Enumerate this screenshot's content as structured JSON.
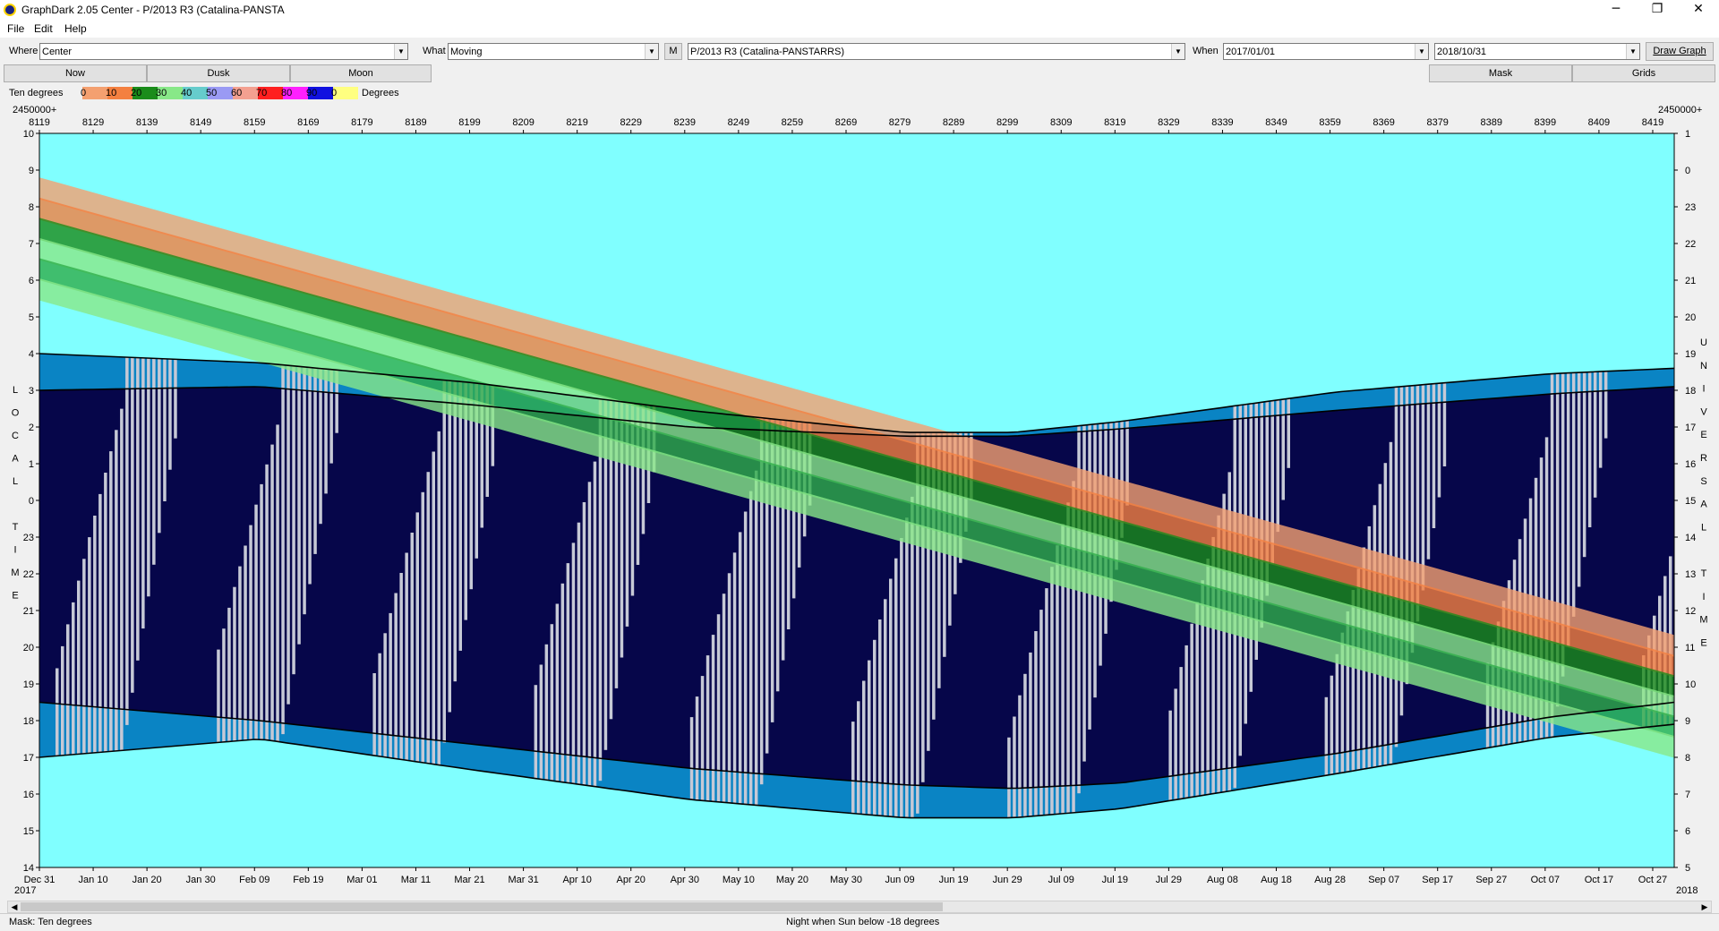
{
  "window": {
    "title": "GraphDark 2.05  Center  -  P/2013 R3 (Catalina-PANSTA",
    "minimize": "─",
    "restore": "❐",
    "close": "✕"
  },
  "menu": [
    "File",
    "Edit",
    "Help"
  ],
  "toolbar": {
    "where_label": "Where",
    "where_value": "Center",
    "what_label": "What",
    "what_value": "Moving",
    "m_button": "M",
    "object_value": "P/2013 R3 (Catalina-PANSTARRS)",
    "when_label": "When",
    "start_date": "2017/01/01",
    "end_date": "2018/10/31",
    "draw_button": "Draw Graph"
  },
  "tabs": {
    "now": "Now",
    "dusk": "Dusk",
    "moon": "Moon",
    "mask": "Mask",
    "grids": "Grids"
  },
  "legend": {
    "title": "Ten degrees",
    "items": [
      {
        "label": "0",
        "color": "#f4a070"
      },
      {
        "label": "10",
        "color": "#f48040"
      },
      {
        "label": "20",
        "color": "#1a8c1a"
      },
      {
        "label": "30",
        "color": "#88e888"
      },
      {
        "label": "40",
        "color": "#66cccc"
      },
      {
        "label": "50",
        "color": "#9a9af4"
      },
      {
        "label": "60",
        "color": "#f4a090"
      },
      {
        "label": "70",
        "color": "#ff2020"
      },
      {
        "label": "80",
        "color": "#ff20ff"
      },
      {
        "label": "90",
        "color": "#1010e0"
      },
      {
        "label": "0",
        "color": "#ffff80"
      }
    ],
    "units": "Degrees"
  },
  "chart_data": {
    "type": "area",
    "jd_prefix_left": "2450000+",
    "jd_prefix_right": "2450000+",
    "jd_ticks": [
      "8119",
      "8129",
      "8139",
      "8149",
      "8159",
      "8169",
      "8179",
      "8189",
      "8199",
      "8209",
      "8219",
      "8229",
      "8239",
      "8249",
      "8259",
      "8269",
      "8279",
      "8289",
      "8299",
      "8309",
      "8319",
      "8329",
      "8339",
      "8349",
      "8359",
      "8369",
      "8379",
      "8389",
      "8399",
      "8409",
      "8419"
    ],
    "date_ticks": [
      "Dec 31",
      "Jan 10",
      "Jan 20",
      "Jan 30",
      "Feb 09",
      "Feb 19",
      "Mar 01",
      "Mar 11",
      "Mar 21",
      "Mar 31",
      "Apr 10",
      "Apr 20",
      "Apr 30",
      "May 10",
      "May 20",
      "May 30",
      "Jun 09",
      "Jun 19",
      "Jun 29",
      "Jul 09",
      "Jul 19",
      "Jul 29",
      "Aug 08",
      "Aug 18",
      "Aug 28",
      "Sep 07",
      "Sep 17",
      "Sep 27",
      "Oct 07",
      "Oct 17",
      "Oct 27"
    ],
    "year_left": "2017",
    "year_right": "2018",
    "left_axis_label": "LOCAL TIME",
    "right_axis_label": "UNIVERSAL TIME",
    "left_ticks": [
      "10",
      "9",
      "8",
      "7",
      "6",
      "5",
      "4",
      "3",
      "2",
      "1",
      "0",
      "23",
      "22",
      "21",
      "20",
      "19",
      "18",
      "17",
      "16",
      "15",
      "14"
    ],
    "right_ticks": [
      "1",
      "0",
      "23",
      "22",
      "21",
      "20",
      "19",
      "18",
      "17",
      "16",
      "15",
      "14",
      "13",
      "12",
      "11",
      "10",
      "9",
      "8",
      "7",
      "6",
      "5"
    ],
    "y_range_hours_local": [
      14,
      34
    ],
    "night_start_local": [
      [
        8119,
        18.5
      ],
      [
        8160,
        18.0
      ],
      [
        8200,
        17.35
      ],
      [
        8240,
        16.7
      ],
      [
        8280,
        16.25
      ],
      [
        8300,
        16.15
      ],
      [
        8320,
        16.3
      ],
      [
        8360,
        17.1
      ],
      [
        8400,
        18.1
      ],
      [
        8423,
        18.5
      ]
    ],
    "night_end_local": [
      [
        8119,
        27.0
      ],
      [
        8160,
        27.1
      ],
      [
        8200,
        26.6
      ],
      [
        8240,
        26.0
      ],
      [
        8280,
        25.75
      ],
      [
        8300,
        25.75
      ],
      [
        8320,
        25.95
      ],
      [
        8360,
        26.45
      ],
      [
        8400,
        26.9
      ],
      [
        8423,
        27.1
      ]
    ],
    "twilight_start_local": [
      [
        8119,
        17.0
      ],
      [
        8160,
        17.5
      ],
      [
        8200,
        16.65
      ],
      [
        8240,
        15.85
      ],
      [
        8280,
        15.35
      ],
      [
        8300,
        15.35
      ],
      [
        8320,
        15.6
      ],
      [
        8360,
        16.55
      ],
      [
        8400,
        17.55
      ],
      [
        8423,
        17.9
      ]
    ],
    "twilight_end_local": [
      [
        8119,
        28.0
      ],
      [
        8160,
        27.75
      ],
      [
        8200,
        27.2
      ],
      [
        8240,
        26.45
      ],
      [
        8280,
        25.85
      ],
      [
        8300,
        25.85
      ],
      [
        8320,
        26.15
      ],
      [
        8360,
        26.95
      ],
      [
        8400,
        27.45
      ],
      [
        8423,
        27.6
      ]
    ],
    "colors": {
      "day": "#80ffff",
      "twilight": "#0a84c4",
      "night": "#06064a",
      "moonlight": "#c6c9d6"
    }
  },
  "status": {
    "mask": "Mask:  Ten degrees",
    "night": "Night when Sun below -18 degrees"
  }
}
